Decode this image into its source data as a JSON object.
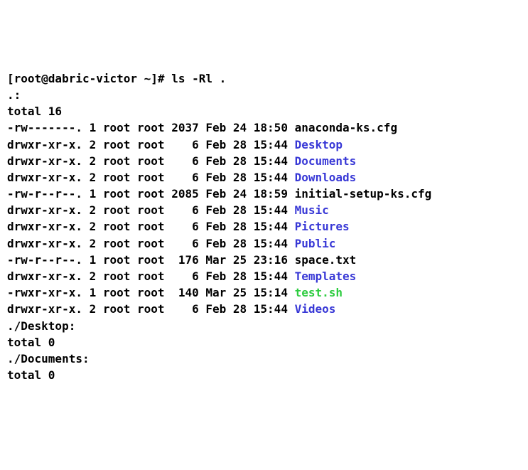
{
  "prompt": {
    "user_host": "[root@dabric-victor ~]#",
    "command": "ls -Rl ."
  },
  "sections": [
    {
      "header": ".:",
      "total": "total 16",
      "entries": [
        {
          "perms": "-rw-------.",
          "links": "1",
          "owner": "root",
          "group": "root",
          "size": "2037",
          "date": "Feb 24 18:50",
          "name": "anaconda-ks.cfg",
          "type": "plain"
        },
        {
          "perms": "drwxr-xr-x.",
          "links": "2",
          "owner": "root",
          "group": "root",
          "size": "6",
          "date": "Feb 28 15:44",
          "name": "Desktop",
          "type": "dir"
        },
        {
          "perms": "drwxr-xr-x.",
          "links": "2",
          "owner": "root",
          "group": "root",
          "size": "6",
          "date": "Feb 28 15:44",
          "name": "Documents",
          "type": "dir"
        },
        {
          "perms": "drwxr-xr-x.",
          "links": "2",
          "owner": "root",
          "group": "root",
          "size": "6",
          "date": "Feb 28 15:44",
          "name": "Downloads",
          "type": "dir"
        },
        {
          "perms": "-rw-r--r--.",
          "links": "1",
          "owner": "root",
          "group": "root",
          "size": "2085",
          "date": "Feb 24 18:59",
          "name": "initial-setup-ks.cfg",
          "type": "plain"
        },
        {
          "perms": "drwxr-xr-x.",
          "links": "2",
          "owner": "root",
          "group": "root",
          "size": "6",
          "date": "Feb 28 15:44",
          "name": "Music",
          "type": "dir"
        },
        {
          "perms": "drwxr-xr-x.",
          "links": "2",
          "owner": "root",
          "group": "root",
          "size": "6",
          "date": "Feb 28 15:44",
          "name": "Pictures",
          "type": "dir"
        },
        {
          "perms": "drwxr-xr-x.",
          "links": "2",
          "owner": "root",
          "group": "root",
          "size": "6",
          "date": "Feb 28 15:44",
          "name": "Public",
          "type": "dir"
        },
        {
          "perms": "-rw-r--r--.",
          "links": "1",
          "owner": "root",
          "group": "root",
          "size": "176",
          "date": "Mar 25 23:16",
          "name": "space.txt",
          "type": "plain"
        },
        {
          "perms": "drwxr-xr-x.",
          "links": "2",
          "owner": "root",
          "group": "root",
          "size": "6",
          "date": "Feb 28 15:44",
          "name": "Templates",
          "type": "dir"
        },
        {
          "perms": "-rwxr-xr-x.",
          "links": "1",
          "owner": "root",
          "group": "root",
          "size": "140",
          "date": "Mar 25 15:14",
          "name": "test.sh",
          "type": "exec"
        },
        {
          "perms": "drwxr-xr-x.",
          "links": "2",
          "owner": "root",
          "group": "root",
          "size": "6",
          "date": "Feb 28 15:44",
          "name": "Videos",
          "type": "dir"
        }
      ]
    },
    {
      "header": "./Desktop:",
      "total": "total 0",
      "entries": []
    },
    {
      "header": "./Documents:",
      "total": "total 0",
      "entries": []
    }
  ]
}
